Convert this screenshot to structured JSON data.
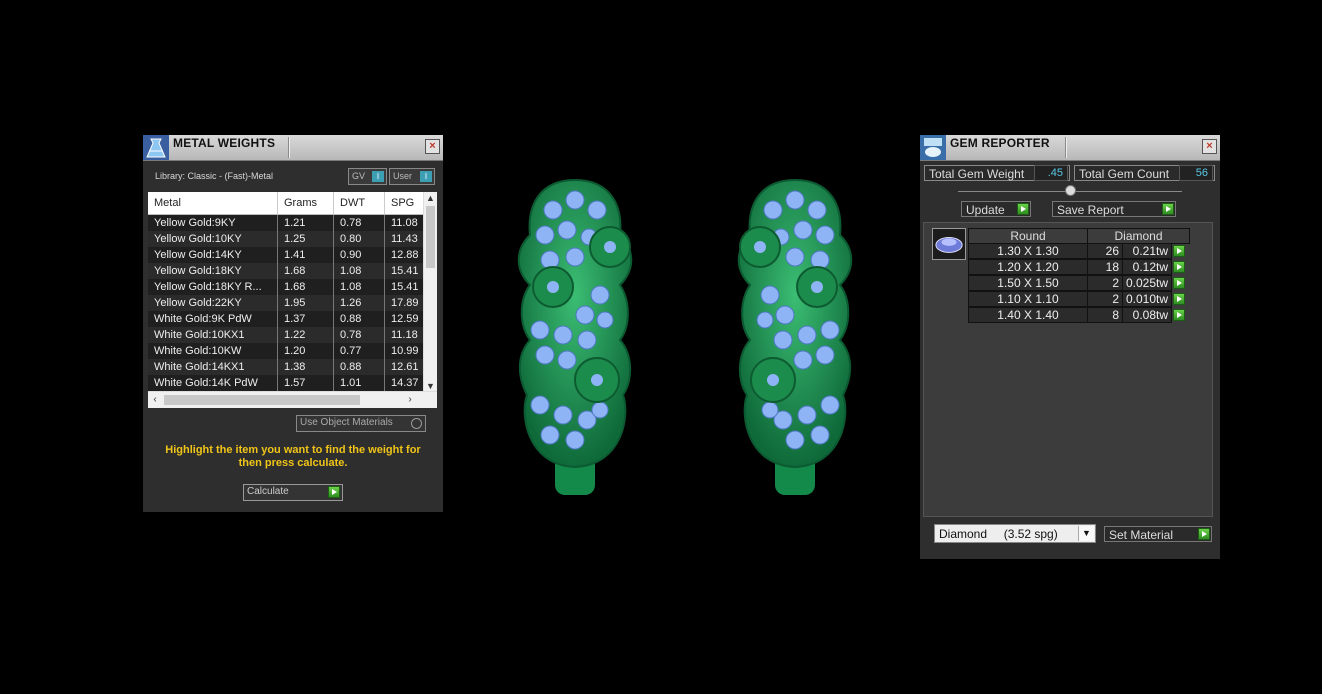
{
  "metal_weights": {
    "title": "METAL WEIGHTS",
    "library": "Library: Classic - (Fast)-Metal",
    "toggle_gv": "GV",
    "toggle_user": "User",
    "toggle_indicator": "I",
    "columns": [
      "Metal",
      "Grams",
      "DWT",
      "SPG"
    ],
    "rows": [
      [
        "Yellow Gold:9KY",
        "1.21",
        "0.78",
        "11.08"
      ],
      [
        "Yellow Gold:10KY",
        "1.25",
        "0.80",
        "11.43"
      ],
      [
        "Yellow Gold:14KY",
        "1.41",
        "0.90",
        "12.88"
      ],
      [
        "Yellow Gold:18KY",
        "1.68",
        "1.08",
        "15.41"
      ],
      [
        "Yellow Gold:18KY R...",
        "1.68",
        "1.08",
        "15.41"
      ],
      [
        "Yellow Gold:22KY",
        "1.95",
        "1.26",
        "17.89"
      ],
      [
        "White Gold:9K PdW",
        "1.37",
        "0.88",
        "12.59"
      ],
      [
        "White Gold:10KX1",
        "1.22",
        "0.78",
        "11.18"
      ],
      [
        "White Gold:10KW",
        "1.20",
        "0.77",
        "10.99"
      ],
      [
        "White Gold:14KX1",
        "1.38",
        "0.88",
        "12.61"
      ],
      [
        "White Gold:14K PdW",
        "1.57",
        "1.01",
        "14.37"
      ]
    ],
    "use_object_materials": "Use Object Materials",
    "hint": "Highlight the item you want to find the weight for then press calculate.",
    "calculate_label": "Calculate"
  },
  "gem_reporter": {
    "title": "GEM REPORTER",
    "total_weight_label": "Total Gem Weight",
    "total_weight_value": ".45",
    "total_count_label": "Total Gem Count",
    "total_count_value": "56",
    "update_label": "Update",
    "save_report_label": "Save Report",
    "table_headers": [
      "Round",
      "Diamond"
    ],
    "rows": [
      [
        "1.30 X 1.30",
        "26",
        "0.21tw"
      ],
      [
        "1.20 X 1.20",
        "18",
        "0.12tw"
      ],
      [
        "1.50 X 1.50",
        "2",
        "0.025tw"
      ],
      [
        "1.10 X 1.10",
        "2",
        "0.010tw"
      ],
      [
        "1.40 X 1.40",
        "8",
        "0.08tw"
      ]
    ],
    "material_selected": "Diamond     (3.52 spg)",
    "set_material_label": "Set Material"
  },
  "colors": {
    "metal_green": "#1a9a55",
    "gem_blue": "#8fb4f5",
    "accent_yellow": "#f0c419",
    "value_cyan": "#59c8e6"
  }
}
